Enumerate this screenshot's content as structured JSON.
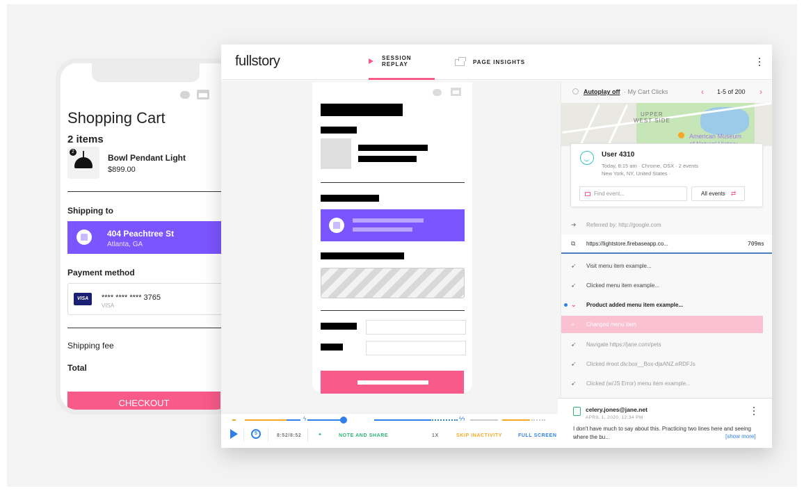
{
  "phone": {
    "title": "Shopping Cart",
    "items_count": "2 items",
    "qty_badge": "2",
    "product_name": "Bowl Pendant Light",
    "product_price": "$899.00",
    "shipping_label": "Shipping to",
    "address_street": "404 Peachtree St",
    "address_city": "Atlanta, GA",
    "payment_label": "Payment method",
    "card_brand": "VISA",
    "card_number": "**** **** **** 3765",
    "card_type": "VISA",
    "shipping_fee_label": "Shipping fee",
    "total_label": "Total",
    "checkout_label": "CHECKOUT"
  },
  "header": {
    "logo": "fullstory",
    "tab_session_replay": "SESSION REPLAY",
    "tab_page_insights": "PAGE INSIGHTS"
  },
  "side": {
    "autoplay": "Autoplay off",
    "playlist": "· My Cart Clicks",
    "pager": "1-5 of 200",
    "map_label_1": "UPPER",
    "map_label_2": "WEST SIDE",
    "map_label_3": "American Museum",
    "map_label_4": "of Natural History",
    "user_name": "User 4310",
    "user_meta": "Today, 8:15 am · Chrome, OSX · 2 events",
    "user_location": "New York, NY, United States ·",
    "find_placeholder": "Find event...",
    "all_events": "All events",
    "referrer": "Referred by: http://google.com",
    "url": "https://lightstore.firebaseapp.co...",
    "url_time": "709ms",
    "events": [
      {
        "label": "Visit menu item example..."
      },
      {
        "label": "Clicked menu item example..."
      },
      {
        "label": "Product added menu item example..."
      },
      {
        "label": "Changed menu item"
      },
      {
        "label": "Navigate https://jane.com/pets"
      },
      {
        "label": "Clicked #root div.box__Box-djaANZ.eRDFJs"
      },
      {
        "label": "Clicked (w/JS Error) menu item example..."
      }
    ]
  },
  "note": {
    "author": "celery.jones@jane.net",
    "date": "APRIL 1, 2020, 12:34 PM",
    "text": "I don't have much to say about this. Practicing two lines here and seeing where the bu...",
    "show_more": "[show more]"
  },
  "player": {
    "time": "8:52/8:52",
    "note_share": "NOTE AND SHARE",
    "speed": "1X",
    "skip": "SKIP INACTIVITY",
    "fullscreen": "FULL SCREEN"
  },
  "colors": {
    "brand_pink": "#f85a8a",
    "purple": "#7b55ff",
    "blue": "#2f80ed",
    "orange": "#f6a623"
  },
  "progress_fraction": 1.0
}
